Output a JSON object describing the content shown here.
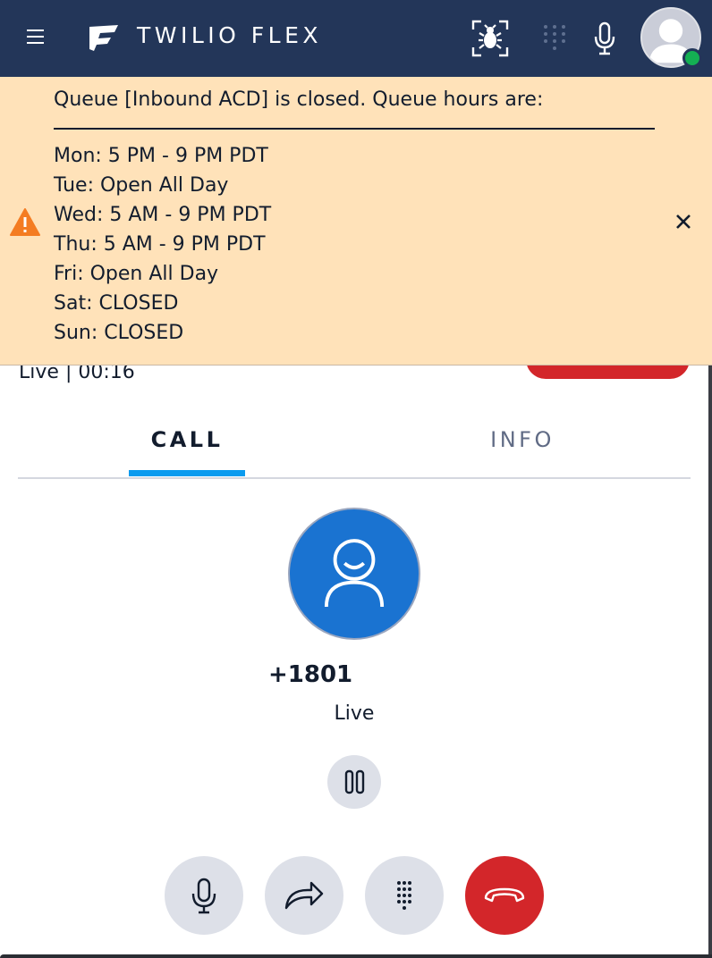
{
  "header": {
    "brand": "TWILIO FLEX",
    "icons": [
      "menu-icon",
      "twilio-logo",
      "bug-icon",
      "dialpad-icon",
      "microphone-icon"
    ],
    "presence_color": "#14b053",
    "background_color": "#233659"
  },
  "banner": {
    "title": "Queue [Inbound ACD] is closed. Queue hours are:",
    "hours": [
      "Mon: 5 PM - 9 PM PDT",
      "Tue: Open All Day",
      "Wed: 5 AM - 9 PM PDT",
      "Thu: 5 AM - 9 PM PDT",
      "Fri: Open All Day",
      "Sat: CLOSED",
      "Sun: CLOSED"
    ],
    "background_color": "#ffe2b9",
    "icon": "warning-icon",
    "close_icon": "close-icon"
  },
  "task": {
    "status": "Live",
    "separator": "|",
    "timer": "00:16"
  },
  "tabs": [
    {
      "label": "CALL",
      "active": true
    },
    {
      "label": "INFO",
      "active": false
    }
  ],
  "caller": {
    "number": "+1801",
    "status": "Live"
  },
  "controls": {
    "hold_icon": "pause-icon",
    "buttons": [
      "microphone-icon",
      "transfer-icon",
      "dialpad-icon",
      "hangup-icon"
    ],
    "hangup_color": "#d3262a",
    "accent_color": "#0a9bef"
  }
}
